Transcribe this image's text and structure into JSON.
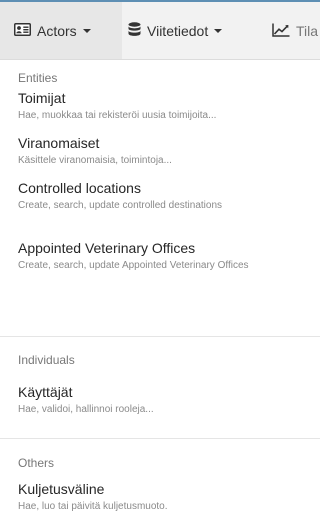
{
  "nav": {
    "actors_label": "Actors",
    "viitetiedot_label": "Viitetiedot",
    "tila_label": "Tila",
    "actors_icon": "id-card-icon",
    "viitetiedot_icon": "database-icon",
    "tila_icon": "line-chart-icon"
  },
  "menu": {
    "sections": [
      {
        "header": "Entities",
        "items": [
          {
            "title": "Toimijat",
            "description": "Hae, muokkaa tai rekisteröi uusia toimijoita..."
          },
          {
            "title": "Viranomaiset",
            "description": "Käsittele viranomaisia, toimintoja..."
          },
          {
            "title": "Controlled locations",
            "description": "Create, search, update controlled destinations"
          },
          {
            "title": "Appointed Veterinary Offices",
            "description": "Create, search, update Appointed Veterinary Offices"
          }
        ]
      },
      {
        "header": "Individuals",
        "items": [
          {
            "title": "Käyttäjät",
            "description": "Hae, validoi, hallinnoi rooleja..."
          }
        ]
      },
      {
        "header": "Others",
        "items": [
          {
            "title": "Kuljetusväline",
            "description": "Hae, luo tai päivitä kuljetusmuoto."
          }
        ]
      }
    ]
  },
  "colors": {
    "top_border": "#5e8fb4",
    "topbar_bg": "#f2f2f2",
    "active_bg": "#e7e7e7"
  }
}
